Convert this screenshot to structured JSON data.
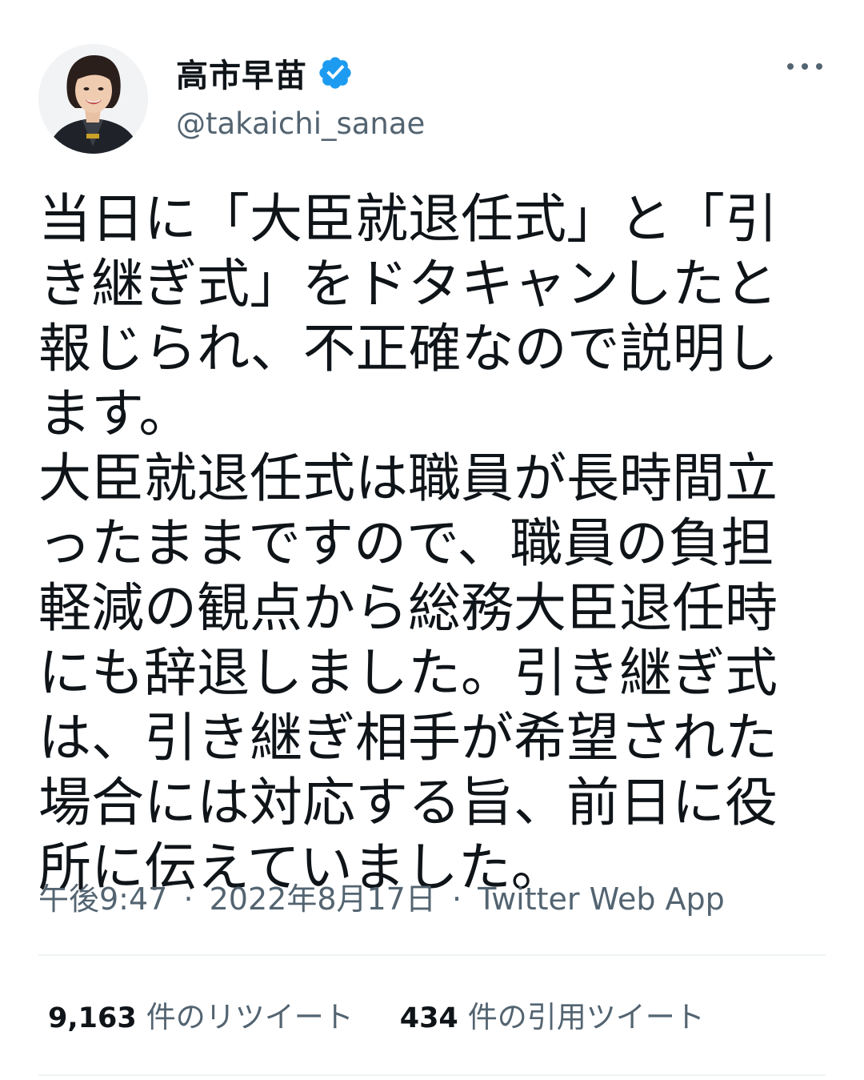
{
  "author": {
    "display_name": "高市早苗",
    "handle": "@takaichi_sanae",
    "verified": true
  },
  "tweet": {
    "text": "当日に「大臣就退任式」と「引き継ぎ式」をドタキャンしたと報じられ、不正確なので説明します。\n大臣就退任式は職員が長時間立ったままですので、職員の負担軽減の観点から総務大臣退任時にも辞退しました。引き継ぎ式は、引き継ぎ相手が希望された場合には対応する旨、前日に役所に伝えていました。",
    "time": "午後9:47",
    "date": "2022年8月17日",
    "source": "Twitter Web App",
    "separator": "·"
  },
  "stats": {
    "retweets_count": "9,163",
    "retweets_label": "件のリツイート",
    "quotes_count": "434",
    "quotes_label": "件の引用ツイート"
  },
  "icons": {
    "more": "more-options-icon",
    "verified": "verified-badge-icon"
  },
  "colors": {
    "verified_blue": "#1d9bf0",
    "secondary_text": "#536471",
    "primary_text": "#0f1419"
  }
}
